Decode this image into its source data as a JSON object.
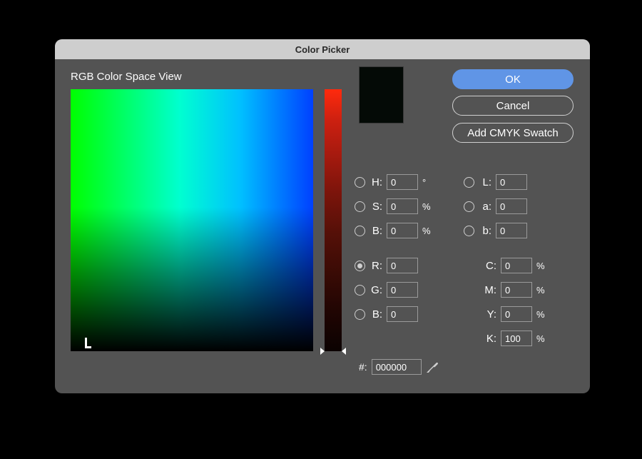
{
  "window": {
    "title": "Color Picker"
  },
  "section_label": "RGB Color Space View",
  "current_color_hex": "#040a06",
  "buttons": {
    "ok": "OK",
    "cancel": "Cancel",
    "add_swatch": "Add CMYK Swatch"
  },
  "radios": {
    "selected": "R"
  },
  "fields": {
    "H": {
      "label": "H:",
      "value": "0",
      "unit": "°"
    },
    "S": {
      "label": "S:",
      "value": "0",
      "unit": "%"
    },
    "B": {
      "label": "B:",
      "value": "0",
      "unit": "%"
    },
    "R": {
      "label": "R:",
      "value": "0",
      "unit": ""
    },
    "G": {
      "label": "G:",
      "value": "0",
      "unit": ""
    },
    "B2": {
      "label": "B:",
      "value": "0",
      "unit": ""
    },
    "L": {
      "label": "L:",
      "value": "0",
      "unit": ""
    },
    "a": {
      "label": "a:",
      "value": "0",
      "unit": ""
    },
    "b": {
      "label": "b:",
      "value": "0",
      "unit": ""
    },
    "C": {
      "label": "C:",
      "value": "0",
      "unit": "%"
    },
    "M": {
      "label": "M:",
      "value": "0",
      "unit": "%"
    },
    "Y": {
      "label": "Y:",
      "value": "0",
      "unit": "%"
    },
    "K": {
      "label": "K:",
      "value": "100",
      "unit": "%"
    }
  },
  "hex": {
    "label": "#:",
    "value": "000000"
  }
}
